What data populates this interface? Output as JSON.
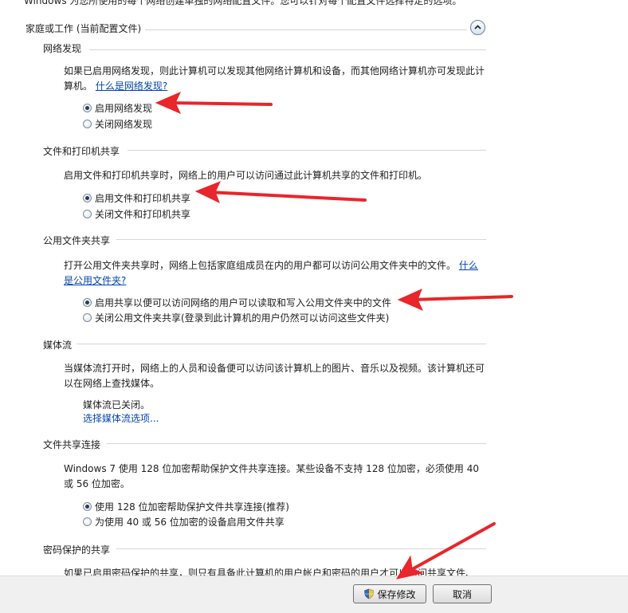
{
  "intro_text": "Windows 为您所使用的每个网络创建单独的网络配置文件。您可以针对每个配置文件选择特定的选项。",
  "group_title": "家庭或工作 (当前配置文件)",
  "sections": {
    "network_discovery": {
      "title": "网络发现",
      "description": "如果已启用网络发现，则此计算机可以发现其他网络计算机和设备，而其他网络计算机亦可发现此计算机。",
      "link": "什么是网络发现?",
      "option_on": "启用网络发现",
      "option_off": "关闭网络发现",
      "selected": "on"
    },
    "file_printer_sharing": {
      "title": "文件和打印机共享",
      "description": "启用文件和打印机共享时，网络上的用户可以访问通过此计算机共享的文件和打印机。",
      "option_on": "启用文件和打印机共享",
      "option_off": "关闭文件和打印机共享",
      "selected": "on"
    },
    "public_folder_sharing": {
      "title": "公用文件夹共享",
      "description": "打开公用文件夹共享时，网络上包括家庭组成员在内的用户都可以访问公用文件夹中的文件。",
      "link": "什么是公用文件夹?",
      "option_on": "启用共享以便可以访问网络的用户可以读取和写入公用文件夹中的文件",
      "option_off": "关闭公用文件夹共享(登录到此计算机的用户仍然可以访问这些文件夹)",
      "selected": "on"
    },
    "media_streaming": {
      "title": "媒体流",
      "description": "当媒体流打开时，网络上的人员和设备便可以访问该计算机上的图片、音乐以及视频。该计算机还可以在网络上查找媒体。",
      "status": "媒体流已关闭。",
      "link": "选择媒体流选项..."
    },
    "file_sharing_connections": {
      "title": "文件共享连接",
      "description": "Windows 7 使用 128 位加密帮助保护文件共享连接。某些设备不支持 128 位加密，必须使用 40 或 56 位加密。",
      "option_128": "使用 128 位加密帮助保护文件共享连接(推荐)",
      "option_40_56": "为使用 40 或 56 位加密的设备启用文件共享",
      "selected": "128"
    },
    "password_protected_sharing": {
      "title": "密码保护的共享",
      "description": "如果已启用密码保护的共享，则只有具备此计算机的用户帐户和密码的用户才可以访问共享文件、"
    }
  },
  "footer": {
    "save_label": "保存修改",
    "cancel_label": "取消"
  },
  "colors": {
    "annotation_arrow": "#e8262b",
    "link": "#0645ad",
    "footer_bg": "#f0f0f0"
  }
}
